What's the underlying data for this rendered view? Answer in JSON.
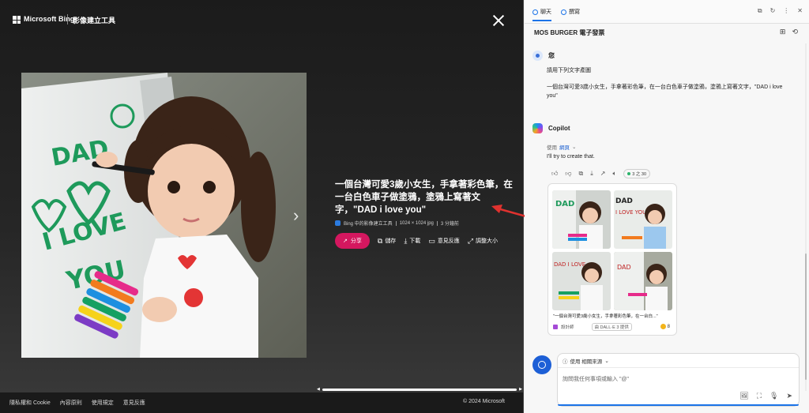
{
  "viewer": {
    "brand": "Microsoft Bing",
    "brand_sub": "影像建立工具",
    "caption": "一個台灣可愛3歲小女生，手拿著彩色筆，在一台白色車子做塗鴉，塗鴉上寫著文字，\"DAD i love you\"",
    "meta": {
      "creator": "Bing 中的影像建立工具",
      "size": "1024 × 1024 jpg",
      "time": "3 分鐘前"
    },
    "actions": {
      "share": "分享",
      "save": "儲存",
      "download": "下載",
      "feedback": "意見反應",
      "resize": "調整大小"
    },
    "footer_links": [
      "隱私權和 Cookie",
      "內容原則",
      "使用規定",
      "意見反應"
    ],
    "copyright": "© 2024 Microsoft"
  },
  "panel": {
    "tabs": [
      "聊天",
      "撰寫"
    ],
    "conversation_title": "MOS BURGER 電子發票",
    "user": {
      "name": "您",
      "line1": "請用下列文字產圖",
      "line2": "一個台灣可愛3歲小女生，手拿著彩色筆，在一台白色車子做塗鴉，塗鴉上寫著文字，\"DAD i love you\""
    },
    "copilot": {
      "name": "Copilot",
      "source_prefix": "使用",
      "source_link": "網頁",
      "reply": "I'll try to create that.",
      "counter": "3 之 30"
    },
    "image_card": {
      "caption": "\"一個台灣可愛3歲小女生，手拿著彩色筆，在一台白...\"",
      "designer": "設計師",
      "dalle": "由 DALL·E 3 提供",
      "count": "8"
    },
    "compose": {
      "source_chip": "使用 相關來源",
      "placeholder": "詢問我任何事項或輸入 \"@\""
    }
  },
  "colors": {
    "share": "#d4175f",
    "accent": "#1b73e8"
  },
  "icons": [
    "close-icon",
    "chevron-right-icon",
    "share-icon",
    "save-icon",
    "download-icon",
    "feedback-icon",
    "resize-icon"
  ]
}
